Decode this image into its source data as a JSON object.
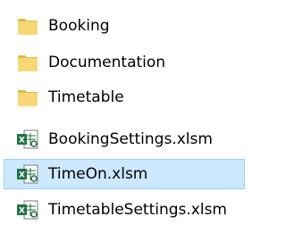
{
  "items": [
    {
      "label": "Booking",
      "type": "folder",
      "icon": "folder-icon"
    },
    {
      "label": "Documentation",
      "type": "folder",
      "icon": "folder-icon"
    },
    {
      "label": "Timetable",
      "type": "folder",
      "icon": "folder-icon"
    },
    {
      "label": "BookingSettings.xlsm",
      "type": "file",
      "icon": "excel-macro-file-icon"
    },
    {
      "label": "TimeOn.xlsm",
      "type": "file",
      "icon": "excel-macro-file-icon",
      "selected": true
    },
    {
      "label": "TimetableSettings.xlsm",
      "type": "file",
      "icon": "excel-macro-file-icon"
    }
  ],
  "colors": {
    "folder": "#f8d775",
    "folder_dark": "#e3b94b",
    "excel_green": "#217346",
    "selection_bg": "#cce8ff",
    "selection_border": "#99d1ff"
  }
}
